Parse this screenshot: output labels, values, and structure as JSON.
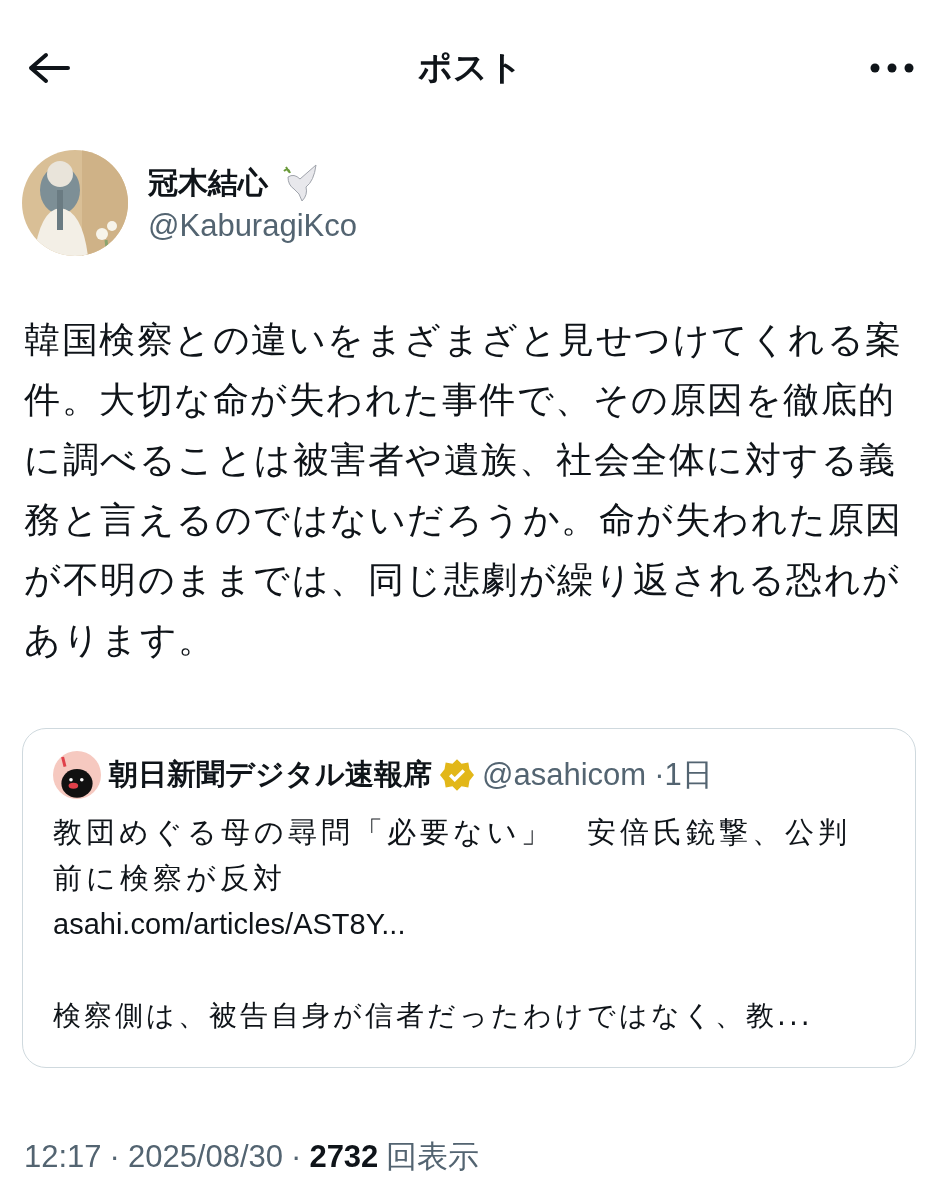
{
  "header": {
    "title": "ポスト"
  },
  "author": {
    "name": "冠木結心",
    "handle": "@KaburagiKco"
  },
  "body": "韓国検察との違いをまざまざと見せつけてくれる案件。大切な命が失われた事件で、その原因を徹底的に調べることは被害者や遺族、社会全体に対する義務と言えるのではないだろうか。命が失われた原因が不明のままでは、同じ悲劇が繰り返される恐れがあります。",
  "quote": {
    "name": "朝日新聞デジタル速報席",
    "verified": true,
    "handle": "@asahicom",
    "time": "·1日",
    "title": "教団めぐる母の尋問「必要ない」　安倍氏銃撃、公判前に検察が反対",
    "link": "asahi.com/articles/AST8Y...",
    "snippet": "検察側は、被告自身が信者だったわけではなく、教..."
  },
  "meta": {
    "time": "12:17",
    "separator": "·",
    "date": "2025/08/30",
    "views": "2732",
    "views_label": "回表示"
  }
}
